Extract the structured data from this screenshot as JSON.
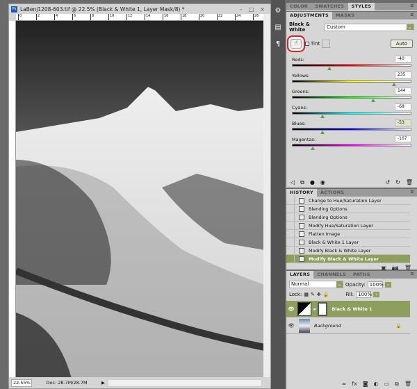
{
  "document": {
    "title": "LaBenj1208-603.tif @ 22.5% (Black & White 1, Layer Mask/8) *",
    "zoom": "22.55%",
    "doc_size": "Doc: 28.7M/28.7M",
    "ruler_ticks": [
      "0",
      "2",
      "4",
      "6",
      "8",
      "10",
      "12",
      "14",
      "16",
      "18",
      "20",
      "22",
      "24",
      "26"
    ]
  },
  "top_tabs": [
    "COLOR",
    "SWATCHES",
    "STYLES"
  ],
  "adjustments": {
    "tabs": [
      "ADJUSTMENTS",
      "MASKS"
    ],
    "title": "Black & White",
    "preset": "Custom",
    "tint_label": "Tint",
    "auto_label": "Auto",
    "sliders": [
      {
        "label": "Reds:",
        "value": "-40",
        "position": 0.32,
        "gradient": "linear-gradient(90deg,#000,#f00,#fff)"
      },
      {
        "label": "Yellows:",
        "value": "235",
        "position": 0.87,
        "gradient": "linear-gradient(90deg,#000,#ff0,#fff)"
      },
      {
        "label": "Greens:",
        "value": "144",
        "position": 0.69,
        "gradient": "linear-gradient(90deg,#000,#0f0,#fff)"
      },
      {
        "label": "Cyans:",
        "value": "-68",
        "position": 0.26,
        "gradient": "linear-gradient(90deg,#000,#0ff,#fff)"
      },
      {
        "label": "Blues:",
        "value": "-53",
        "position": 0.26,
        "gradient": "linear-gradient(90deg,#000,#00f,#fff)"
      },
      {
        "label": "Magentas:",
        "value": "-107",
        "position": 0.18,
        "gradient": "linear-gradient(90deg,#000,#f0f,#fff)"
      }
    ]
  },
  "history": {
    "tabs": [
      "HISTORY",
      "ACTIONS"
    ],
    "items": [
      "Change to Hue/Saturation Layer",
      "Blending Options",
      "Blending Options",
      "Modify Hue/Saturation Layer",
      "Flatten Image",
      "Black & White 1 Layer",
      "Modify Black & White Layer",
      "Modify Black & White Layer"
    ]
  },
  "layers": {
    "tabs": [
      "LAYERS",
      "CHANNELS",
      "PATHS"
    ],
    "blend_mode": "Normal",
    "opacity_label": "Opacity:",
    "opacity": "100%",
    "lock_label": "Lock:",
    "fill_label": "Fill:",
    "fill": "100%",
    "items": [
      "Black & White 1",
      "Background"
    ]
  },
  "colors": {
    "selection": "#8d9e5d"
  }
}
